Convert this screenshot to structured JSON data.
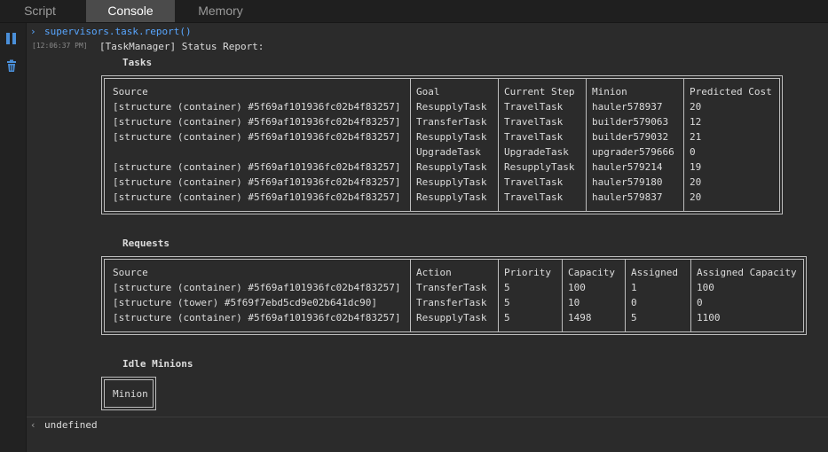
{
  "tabs": [
    {
      "label": "Script",
      "active": false
    },
    {
      "label": "Console",
      "active": true
    },
    {
      "label": "Memory",
      "active": false
    }
  ],
  "sidebar": {
    "pause_icon": "pause-icon",
    "clear_icon": "trash-icon"
  },
  "console": {
    "command": "supervisors.task.report()",
    "timestamp": "[12:06:37 PM]",
    "message": "[TaskManager] Status Report:",
    "result": "undefined"
  },
  "tasks": {
    "heading": "Tasks",
    "columns": [
      "Source",
      "Goal",
      "Current Step",
      "Minion",
      "Predicted Cost"
    ],
    "rows": [
      [
        "[structure (container) #5f69af101936fc02b4f83257]",
        "ResupplyTask",
        "TravelTask",
        "hauler578937",
        "20"
      ],
      [
        "[structure (container) #5f69af101936fc02b4f83257]",
        "TransferTask",
        "TravelTask",
        "builder579063",
        "12"
      ],
      [
        "[structure (container) #5f69af101936fc02b4f83257]",
        "ResupplyTask",
        "TravelTask",
        "builder579032",
        "21"
      ],
      [
        "",
        "UpgradeTask",
        "UpgradeTask",
        "upgrader579666",
        "0"
      ],
      [
        "[structure (container) #5f69af101936fc02b4f83257]",
        "ResupplyTask",
        "ResupplyTask",
        "hauler579214",
        "19"
      ],
      [
        "[structure (container) #5f69af101936fc02b4f83257]",
        "ResupplyTask",
        "TravelTask",
        "hauler579180",
        "20"
      ],
      [
        "[structure (container) #5f69af101936fc02b4f83257]",
        "ResupplyTask",
        "TravelTask",
        "hauler579837",
        "20"
      ]
    ]
  },
  "requests": {
    "heading": "Requests",
    "columns": [
      "Source",
      "Action",
      "Priority",
      "Capacity",
      "Assigned",
      "Assigned Capacity"
    ],
    "rows": [
      [
        "[structure (container) #5f69af101936fc02b4f83257]",
        "TransferTask",
        "5",
        "100",
        "1",
        "100"
      ],
      [
        "[structure (tower) #5f69f7ebd5cd9e02b641dc90]",
        "TransferTask",
        "5",
        "10",
        "0",
        "0"
      ],
      [
        "[structure (container) #5f69af101936fc02b4f83257]",
        "ResupplyTask",
        "5",
        "1498",
        "5",
        "1100"
      ]
    ]
  },
  "idle": {
    "heading": "Idle Minions",
    "columns": [
      "Minion"
    ],
    "rows": []
  }
}
